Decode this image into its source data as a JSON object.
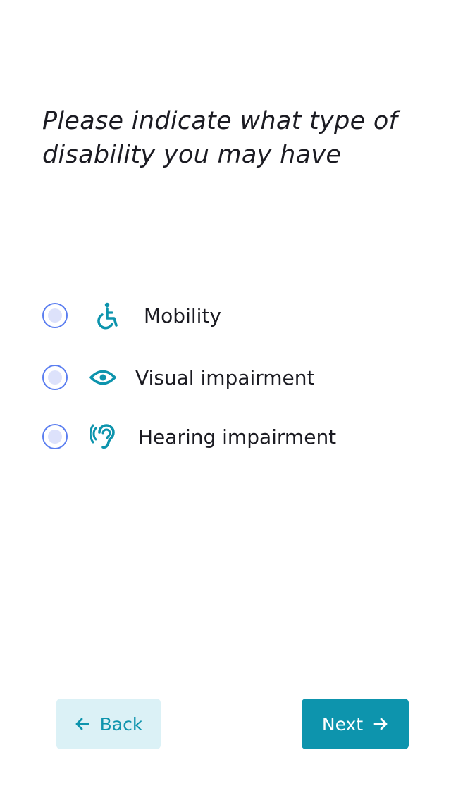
{
  "question": {
    "title": "Please indicate what type of disability you may have"
  },
  "options": [
    {
      "label": "Mobility",
      "icon": "wheelchair-icon",
      "selected": false
    },
    {
      "label": "Visual impairment",
      "icon": "eye-icon",
      "selected": false
    },
    {
      "label": "Hearing impairment",
      "icon": "ear-icon",
      "selected": false
    }
  ],
  "navigation": {
    "back_label": "Back",
    "back_icon": "arrow-left-icon",
    "next_label": "Next",
    "next_icon": "arrow-right-icon"
  },
  "colors": {
    "accent": "#0d94ad",
    "accent_light": "#dbf1f6",
    "radio_border": "#5b7ef0",
    "radio_fill": "#dde2fb",
    "text": "#1b1b22"
  }
}
